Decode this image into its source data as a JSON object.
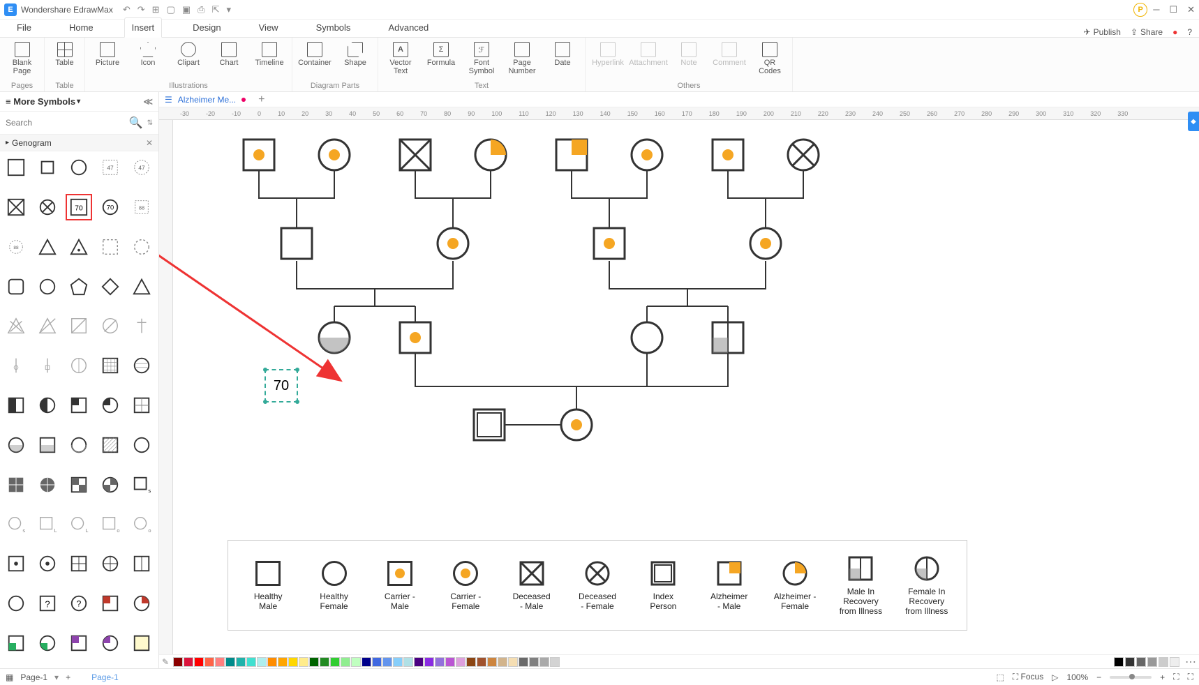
{
  "app": {
    "name": "Wondershare EdrawMax"
  },
  "qat": {
    "undo": "↶",
    "redo": "↷",
    "new": "⊞",
    "open": "▢",
    "save": "▣",
    "print": "⎙",
    "export": "⇱",
    "more": "▾"
  },
  "menu": {
    "items": [
      "File",
      "Home",
      "Insert",
      "Design",
      "View",
      "Symbols",
      "Advanced"
    ],
    "active": "Insert",
    "publish": "Publish",
    "share": "Share"
  },
  "ribbon": {
    "pages": {
      "label": "Pages",
      "blank": "Blank\nPage"
    },
    "table": {
      "label": "Table",
      "table": "Table"
    },
    "ill": {
      "label": "Illustrations",
      "picture": "Picture",
      "icon": "Icon",
      "clipart": "Clipart",
      "chart": "Chart",
      "timeline": "Timeline"
    },
    "parts": {
      "label": "Diagram Parts",
      "container": "Container",
      "shape": "Shape"
    },
    "text": {
      "label": "Text",
      "vector": "Vector\nText",
      "formula": "Formula",
      "font": "Font\nSymbol",
      "page": "Page\nNumber",
      "date": "Date"
    },
    "others": {
      "label": "Others",
      "hyper": "Hyperlink",
      "attach": "Attachment",
      "note": "Note",
      "comment": "Comment",
      "qr": "QR\nCodes"
    }
  },
  "side": {
    "header": "More Symbols",
    "search_ph": "Search",
    "section": "Genogram",
    "sym70": "70",
    "sym47": "47",
    "sym88": "88",
    "symQ": "?"
  },
  "doc": {
    "tab": "Alzheimer Me..."
  },
  "ruler": [
    "-30",
    "-20",
    "-10",
    "0",
    "10",
    "20",
    "30",
    "40",
    "50",
    "60",
    "70",
    "80",
    "90",
    "100",
    "110",
    "120",
    "130",
    "140",
    "150",
    "160",
    "170",
    "180",
    "190",
    "200",
    "210",
    "220",
    "230",
    "240",
    "250",
    "260",
    "270",
    "280",
    "290",
    "300",
    "310",
    "320",
    "330"
  ],
  "dropped": {
    "value": "70"
  },
  "legend": {
    "items": [
      {
        "l1": "Healthy",
        "l2": "Male"
      },
      {
        "l1": "Healthy",
        "l2": "Female"
      },
      {
        "l1": "Carrier -",
        "l2": "Male"
      },
      {
        "l1": "Carrier -",
        "l2": "Female"
      },
      {
        "l1": "Deceased",
        "l2": "- Male"
      },
      {
        "l1": "Deceased",
        "l2": "- Female"
      },
      {
        "l1": "Index",
        "l2": "Person"
      },
      {
        "l1": "Alzheimer",
        "l2": "- Male"
      },
      {
        "l1": "Alzheimer -",
        "l2": "Female"
      },
      {
        "l1": "Male In",
        "l2": "Recovery",
        "l3": "from Illness"
      },
      {
        "l1": "Female In",
        "l2": "Recovery",
        "l3": "from Illness"
      }
    ]
  },
  "status": {
    "page": "Page-1",
    "tab": "Page-1",
    "focus": "Focus",
    "zoom": "100%"
  },
  "colors": [
    "#8b0000",
    "#dc143c",
    "#ff0000",
    "#ff6347",
    "#ff7f7f",
    "#008b8b",
    "#20b2aa",
    "#40e0d0",
    "#afeeee",
    "#ff8c00",
    "#ffa500",
    "#ffd700",
    "#ffec8b",
    "#006400",
    "#228b22",
    "#32cd32",
    "#90ee90",
    "#c0ffc0",
    "#00008b",
    "#4169e1",
    "#6495ed",
    "#87cefa",
    "#b0e0e6",
    "#4b0082",
    "#8a2be2",
    "#9370db",
    "#ba55d3",
    "#dda0dd",
    "#8b4513",
    "#a0522d",
    "#cd853f",
    "#d2b48c",
    "#f5deb3",
    "#696969",
    "#808080",
    "#a9a9a9",
    "#d3d3d3"
  ]
}
